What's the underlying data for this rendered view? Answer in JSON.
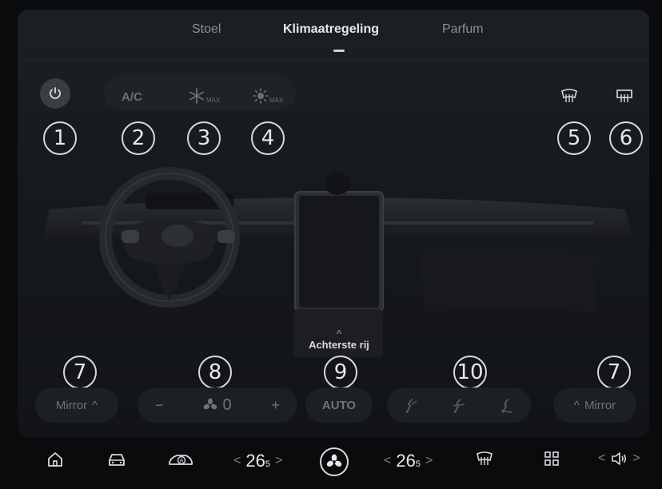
{
  "tabs": [
    {
      "label": "Stoel"
    },
    {
      "label": "Klimaatregeling",
      "active": true
    },
    {
      "label": "Parfum"
    }
  ],
  "controls": {
    "ac_label": "A/C",
    "max_label": "MAX",
    "auto_label": "AUTO",
    "fan_speed": "0",
    "fan_minus": "−",
    "fan_plus": "+",
    "mirror_label": "Mirror",
    "rear_row_label": "Achterste rij",
    "caret_up": "^"
  },
  "callouts": [
    "1",
    "2",
    "3",
    "4",
    "5",
    "6",
    "7",
    "8",
    "9",
    "10",
    "7"
  ],
  "taskbar": {
    "temp_left": "26",
    "temp_left_frac": "5",
    "temp_right": "26",
    "temp_right_frac": "5",
    "chev_left": "<",
    "chev_right": ">"
  },
  "colors": {
    "accent": "#e6e8eb",
    "panel": "#1c1f24",
    "muted": "#6b7076"
  }
}
